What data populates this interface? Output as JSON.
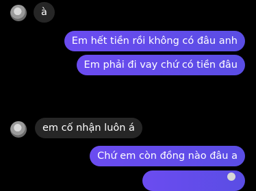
{
  "messages": {
    "m1": {
      "text": "à"
    },
    "m2": {
      "text": "Em hết tiền rồi không có đâu anh"
    },
    "m3": {
      "text": "Em phải đi vay chứ có tiền đâu"
    },
    "m4": {
      "text": "😢"
    },
    "m5": {
      "text": "em cố nhận luôn á"
    },
    "m6": {
      "text": "Chứ em còn đồng nào đâu a"
    }
  },
  "colors": {
    "incoming_bubble": "#262626",
    "outgoing_bubble": "#5d4ee6",
    "background": "#000000"
  },
  "icons": {
    "avatar": "user-avatar",
    "reaction": "crying-face-emoji"
  }
}
